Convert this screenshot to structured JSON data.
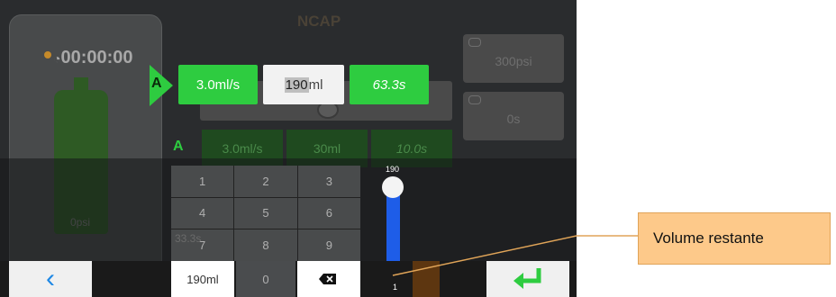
{
  "screen": {
    "title": "NCAP"
  },
  "syringe": {
    "timer": "00:00:00",
    "pressure": "0psi",
    "color": "#2e5a24"
  },
  "phase_a": {
    "label": "A",
    "flow": "3.0ml/s",
    "volume_value": "190",
    "volume_unit": "ml",
    "duration": "63.3s"
  },
  "phase_b": {
    "label": "A",
    "flow": "3.0ml/s",
    "volume": "30ml",
    "duration": "10.0s"
  },
  "side": {
    "pressure_limit": "300psi",
    "delay": "0s"
  },
  "keypad": {
    "keys": [
      "1",
      "2",
      "3",
      "4",
      "5",
      "6",
      "7",
      "8",
      "9"
    ],
    "zero": "0",
    "entry": "190ml",
    "ghost_text": "33.3s"
  },
  "slider": {
    "max_label": "190",
    "min_label": "1",
    "value": 190,
    "color": "#1e5de8"
  },
  "nav": {
    "back": "‹",
    "enter_icon": "enter-arrow-icon",
    "accent": "#2ecc40"
  },
  "annotation": {
    "text": "Volume restante",
    "color": "#fdc98a"
  }
}
